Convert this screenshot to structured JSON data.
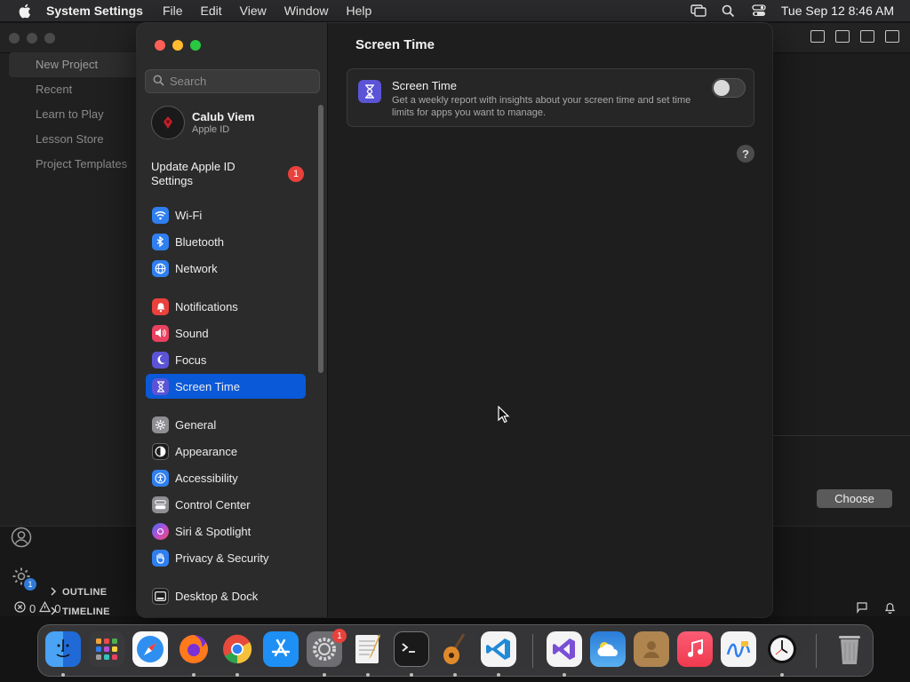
{
  "menubar": {
    "app_name": "System Settings",
    "menus": [
      "File",
      "Edit",
      "View",
      "Window",
      "Help"
    ],
    "clock": "Tue Sep 12  8:46 AM"
  },
  "background_app": {
    "nav": [
      "New Project",
      "Recent",
      "Learn to Play",
      "Lesson Store",
      "Project Templates"
    ],
    "choose_button": "Choose",
    "sections": [
      "OUTLINE",
      "TIMELINE"
    ],
    "settings_badge": "1",
    "status": {
      "errors": "0",
      "warnings": "0"
    }
  },
  "settings": {
    "search_placeholder": "Search",
    "account": {
      "name": "Calub Viem",
      "subtitle": "Apple ID"
    },
    "update": {
      "label": "Update Apple ID Settings",
      "badge": "1"
    },
    "sidebar": [
      {
        "label": "Wi-Fi",
        "icon": "wifi-icon",
        "color": "#2f7ff0"
      },
      {
        "label": "Bluetooth",
        "icon": "bluetooth-icon",
        "color": "#2f7ff0"
      },
      {
        "label": "Network",
        "icon": "globe-icon",
        "color": "#2f7ff0"
      },
      {
        "label": "Notifications",
        "icon": "bell-icon",
        "color": "#e9413c"
      },
      {
        "label": "Sound",
        "icon": "speaker-icon",
        "color": "#e9415f"
      },
      {
        "label": "Focus",
        "icon": "moon-icon",
        "color": "#5b54d6"
      },
      {
        "label": "Screen Time",
        "icon": "hourglass-icon",
        "color": "#5b54d6"
      },
      {
        "label": "General",
        "icon": "gear-icon",
        "color": "#8e8e93"
      },
      {
        "label": "Appearance",
        "icon": "appearance-icon",
        "color": "#1c1c1e"
      },
      {
        "label": "Accessibility",
        "icon": "accessibility-icon",
        "color": "#2f7ff0"
      },
      {
        "label": "Control Center",
        "icon": "control-center-icon",
        "color": "#8e8e93"
      },
      {
        "label": "Siri & Spotlight",
        "icon": "siri-icon",
        "color": "#b84fd6"
      },
      {
        "label": "Privacy & Security",
        "icon": "hand-icon",
        "color": "#2f7ff0"
      },
      {
        "label": "Desktop & Dock",
        "icon": "dock-icon",
        "color": "#1c1c1e"
      }
    ],
    "selected": "Screen Time",
    "content": {
      "title": "Screen Time",
      "card_title": "Screen Time",
      "card_desc": "Get a weekly report with insights about your screen time and set time limits for apps you want to manage.",
      "toggle_on": false,
      "help": "?"
    }
  },
  "dock": {
    "apps": [
      "finder-icon",
      "launchpad-icon",
      "safari-icon",
      "firefox-icon",
      "chrome-icon",
      "app-store-icon",
      "system-settings-icon",
      "textedit-icon",
      "terminal-icon",
      "garageband-icon",
      "vscode-icon",
      "visual-studio-icon",
      "weather-icon",
      "contacts-icon",
      "music-icon",
      "freeform-icon",
      "clock-icon",
      "trash-icon"
    ],
    "settings_badge": "1"
  },
  "colors": {
    "accent": "#0a59d8",
    "badge": "#e9413c"
  }
}
